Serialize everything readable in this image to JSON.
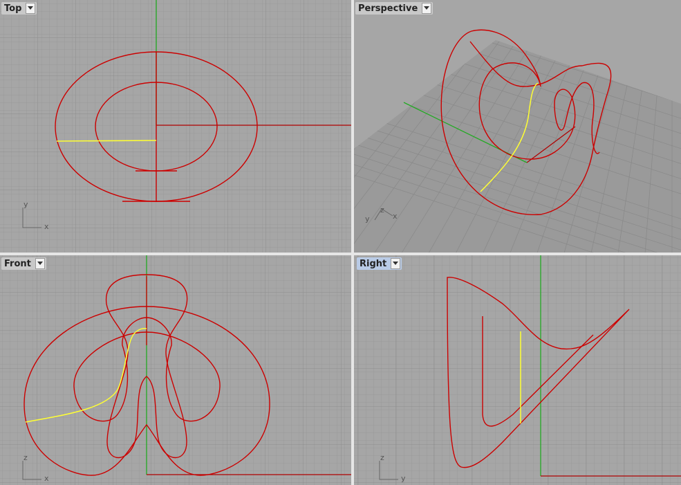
{
  "viewports": [
    {
      "id": "top",
      "title": "Top",
      "active": false,
      "axes": [
        "y",
        "x"
      ]
    },
    {
      "id": "perspective",
      "title": "Perspective",
      "active": false,
      "axes": [
        "z",
        "y",
        "x"
      ]
    },
    {
      "id": "front",
      "title": "Front",
      "active": false,
      "axes": [
        "z",
        "x"
      ]
    },
    {
      "id": "right",
      "title": "Right",
      "active": true,
      "axes": [
        "z",
        "y"
      ]
    }
  ],
  "colors": {
    "background": "#a6a6a6",
    "grid_minor": "#989898",
    "grid_major": "#8c8c8c",
    "curve": "#cc0000",
    "selected_curve": "#ffff33",
    "axis_x": "#b00000",
    "axis_y": "#22aa22"
  },
  "icons": {
    "dropdown": "dropdown-arrow-icon"
  }
}
